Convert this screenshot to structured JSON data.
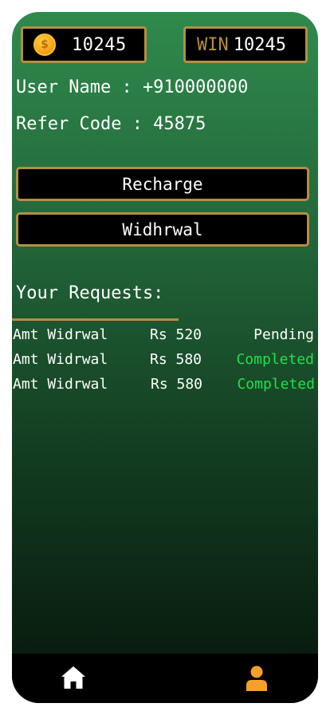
{
  "wallet": {
    "coin_icon": "coin-icon",
    "coin_symbol": "$",
    "coin_value": "10245",
    "win_label": "WIN",
    "win_value": "10245"
  },
  "profile": {
    "user_name_text": "User Name : +910000000",
    "refer_code_text": "Refer Code : 45875"
  },
  "actions": {
    "recharge_label": "Recharge",
    "withdraw_label": "Widhrwal"
  },
  "requests": {
    "title": "Your Requests:",
    "rows": [
      {
        "type": "Amt Widrwal",
        "amount": "Rs 520",
        "status": "Pending"
      },
      {
        "type": "Amt Widrwal",
        "amount": "Rs 580",
        "status": "Completed"
      },
      {
        "type": "Amt Widrwal",
        "amount": "Rs 580",
        "status": "Completed"
      }
    ]
  },
  "nav": {
    "home_icon": "home-icon",
    "profile_icon": "user-icon"
  },
  "colors": {
    "gold_border": "#b58e43",
    "completed_green": "#22e04a",
    "profile_icon_orange": "#f5a02a"
  }
}
